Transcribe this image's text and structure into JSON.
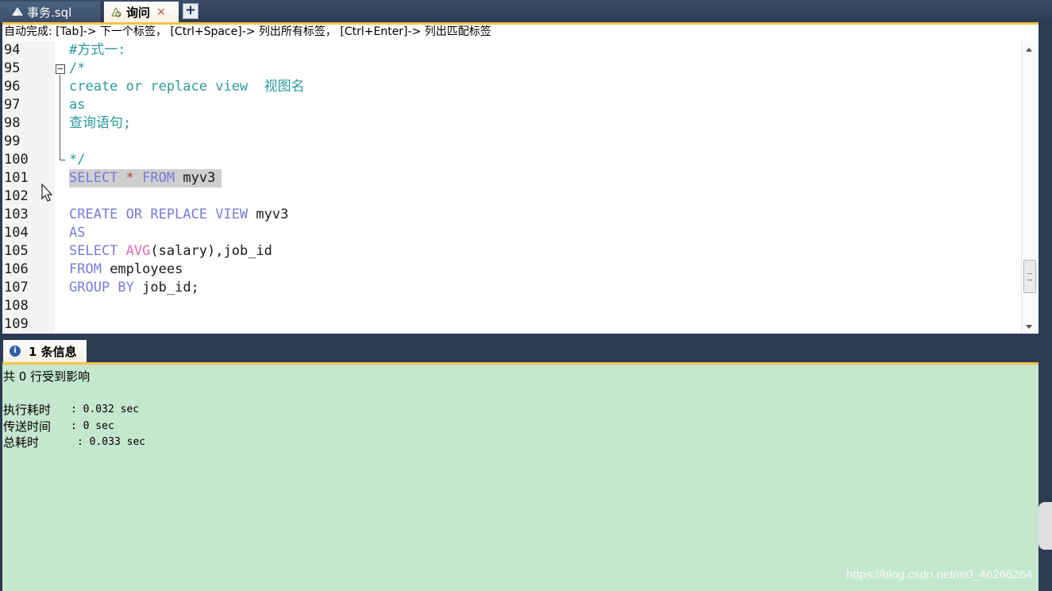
{
  "tabs": [
    {
      "label": "事务.sql",
      "active": false
    },
    {
      "label": "询问",
      "active": true
    }
  ],
  "add_tab_label": "+",
  "close_glyph": "×",
  "hint": "自动完成: [Tab]-> 下一个标签， [Ctrl+Space]-> 列出所有标签， [Ctrl+Enter]-> 列出匹配标签",
  "editor": {
    "line_numbers": [
      "94",
      "95",
      "96",
      "97",
      "98",
      "99",
      "100",
      "101",
      "102",
      "103",
      "104",
      "105",
      "106",
      "107",
      "108",
      "109"
    ],
    "lines": [
      {
        "n": "94",
        "text": "#方式一:"
      },
      {
        "n": "95",
        "text": "/*"
      },
      {
        "n": "96",
        "text": "create or replace view  视图名"
      },
      {
        "n": "97",
        "text": "as"
      },
      {
        "n": "98",
        "text": "查询语句;"
      },
      {
        "n": "99",
        "text": ""
      },
      {
        "n": "100",
        "text": "*/"
      },
      {
        "n": "101",
        "text": "SELECT * FROM myv3 ",
        "selected": true
      },
      {
        "n": "102",
        "text": ""
      },
      {
        "n": "103",
        "text": "CREATE OR REPLACE VIEW myv3"
      },
      {
        "n": "104",
        "text": "AS"
      },
      {
        "n": "105",
        "text": "SELECT AVG(salary),job_id"
      },
      {
        "n": "106",
        "text": "FROM employees"
      },
      {
        "n": "107",
        "text": "GROUP BY job_id;"
      },
      {
        "n": "108",
        "text": ""
      },
      {
        "n": "109",
        "text": ""
      }
    ],
    "tokens": {
      "l94": "#方式一:",
      "l95": "/*",
      "l96": "create or replace view  视图名",
      "l97": "as",
      "l98": "查询语句;",
      "l100": "*/",
      "l101_select": "SELECT",
      "l101_star": "*",
      "l101_from": "FROM",
      "l101_id": "myv3",
      "l103_kw": "CREATE OR REPLACE VIEW",
      "l103_id": "myv3",
      "l104_kw": "AS",
      "l105_kw": "SELECT",
      "l105_fn": "AVG",
      "l105_rest": "(salary),job_id",
      "l106_kw": "FROM",
      "l106_id": "employees",
      "l107_kw": "GROUP BY",
      "l107_id": "job_id;"
    },
    "colors": {
      "comment": "#2c9a9a",
      "keyword": "#7a7ad8",
      "function": "#e06cb0",
      "operator": "#c43a3a",
      "selection": "#cfcfcf"
    }
  },
  "results_panel": {
    "tab_label": "1 条信息",
    "summary": "共 0 行受到影响",
    "stats": [
      {
        "label": "执行耗时",
        "value": ": 0.032 sec"
      },
      {
        "label": "传送时间",
        "value": ": 0 sec"
      },
      {
        "label": "总耗时",
        "value": ": 0.033 sec"
      }
    ],
    "background": "#c4e7cd"
  },
  "watermark": "https://blog.csdn.net/m0_46266264"
}
